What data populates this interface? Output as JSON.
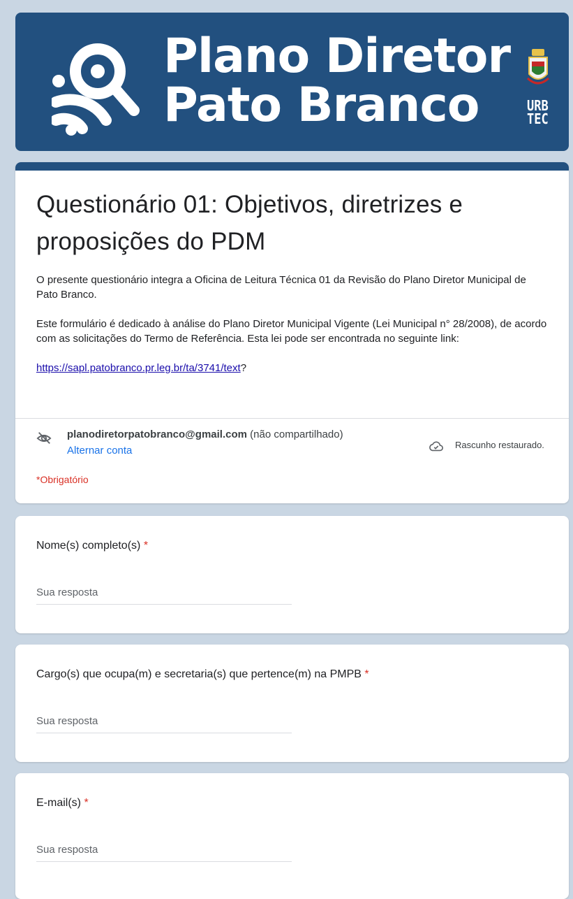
{
  "banner": {
    "title_line1": "Plano Diretor",
    "title_line2": "Pato Branco",
    "partner_line1": "URB",
    "partner_line2": "TEC"
  },
  "form": {
    "title": "Questionário 01: Objetivos, diretrizes e proposições do PDM",
    "description_p1": "O presente questionário integra a Oficina de Leitura Técnica 01 da Revisão do Plano Diretor Municipal de Pato Branco.",
    "description_p2": "Este formulário é dedicado à análise do Plano Diretor Municipal Vigente (Lei Municipal n° 28/2008), de acordo com as solicitações do Termo de Referência. Esta lei pode ser encontrada no seguinte link:",
    "link_text": "https://sapl.patobranco.pr.leg.br/ta/3741/text",
    "link_suffix": "?"
  },
  "account": {
    "email": "planodiretorpatobranco@gmail.com",
    "share_status": " (não compartilhado)",
    "switch_label": "Alternar conta",
    "draft_status": "Rascunho restaurado.",
    "required_note": "*Obrigatório"
  },
  "questions": [
    {
      "label": "Nome(s) completo(s)",
      "required_mark": "*",
      "placeholder": "Sua resposta"
    },
    {
      "label": "Cargo(s) que ocupa(m) e secretaria(s) que pertence(m) na PMPB",
      "required_mark": "*",
      "placeholder": "Sua resposta"
    },
    {
      "label": "E-mail(s)",
      "required_mark": "*",
      "placeholder": "Sua resposta"
    }
  ],
  "colors": {
    "brand": "#22507f",
    "background": "#c9d6e3",
    "required": "#d93025",
    "link": "#1a73e8"
  },
  "icons": [
    "logo-mark-icon",
    "crest-icon",
    "eye-off-icon",
    "cloud-check-icon"
  ]
}
